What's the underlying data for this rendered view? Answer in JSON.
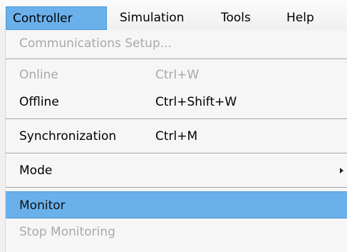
{
  "menubar": {
    "items": [
      {
        "label": "Controller"
      },
      {
        "label": "Simulation"
      },
      {
        "label": "Tools"
      },
      {
        "label": "Help"
      }
    ]
  },
  "dropdown": {
    "communications_setup": {
      "label": "Communications Setup..."
    },
    "online": {
      "label": "Online",
      "shortcut": "Ctrl+W"
    },
    "offline": {
      "label": "Offline",
      "shortcut": "Ctrl+Shift+W"
    },
    "synchronization": {
      "label": "Synchronization",
      "shortcut": "Ctrl+M"
    },
    "mode": {
      "label": "Mode"
    },
    "monitor": {
      "label": "Monitor"
    },
    "stop_monitoring": {
      "label": "Stop Monitoring"
    }
  },
  "colors": {
    "highlight": "#6ab1ec",
    "highlight_border": "#4a95d6",
    "disabled_text": "#a9a9a9"
  }
}
